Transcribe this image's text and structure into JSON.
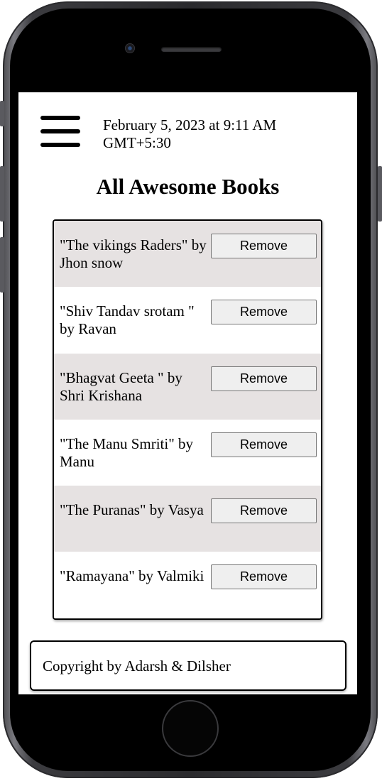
{
  "header": {
    "datetime": "February 5, 2023 at 9:11 AM GMT+5:30"
  },
  "main": {
    "title": "All Awesome Books",
    "books": [
      {
        "text": "\"The vikings Raders\" by Jhon snow",
        "button": "Remove"
      },
      {
        "text": "\"Shiv Tandav srotam \" by Ravan",
        "button": "Remove"
      },
      {
        "text": "\"Bhagvat Geeta \" by Shri Krishana",
        "button": "Remove"
      },
      {
        "text": "\"The Manu Smriti\" by Manu",
        "button": "Remove"
      },
      {
        "text": "\"The Puranas\" by Vasya",
        "button": "Remove"
      },
      {
        "text": "\"Ramayana\" by Valmiki",
        "button": "Remove"
      }
    ]
  },
  "footer": {
    "text": "Copyright by Adarsh & Dilsher"
  },
  "icons": {
    "menu": "hamburger-menu-icon"
  },
  "colors": {
    "row_shaded": "#e6e2e2",
    "button_bg": "#efefef"
  }
}
